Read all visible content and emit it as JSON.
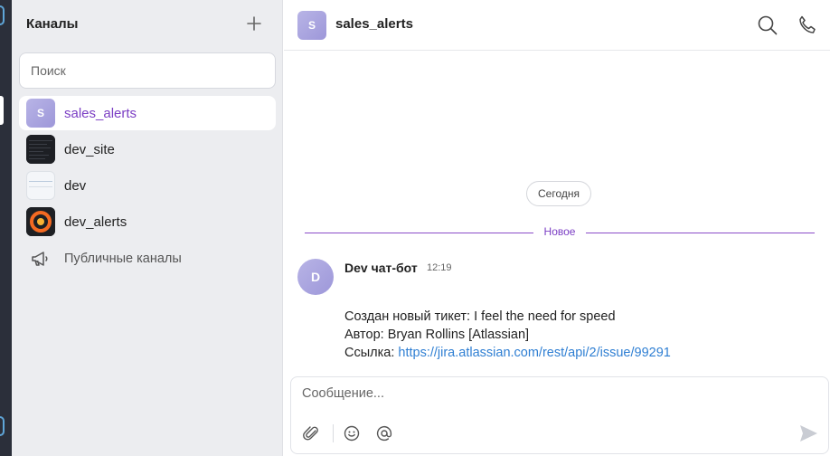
{
  "sidebar": {
    "header": "Каналы",
    "search_placeholder": "Поиск",
    "channels": [
      {
        "label": "sales_alerts",
        "avatar_letter": "S",
        "active": true
      },
      {
        "label": "dev_site",
        "active": false
      },
      {
        "label": "dev",
        "active": false
      },
      {
        "label": "dev_alerts",
        "active": false
      }
    ],
    "public_channels": "Публичные каналы"
  },
  "chat": {
    "title": "sales_alerts",
    "avatar_letter": "S",
    "date_divider": "Сегодня",
    "new_divider": "Новое",
    "message": {
      "avatar_letter": "D",
      "author": "Dev чат-бот",
      "time": "12:19",
      "line1": "Создан новый тикет: I feel the need for speed",
      "line2": "Автор: Bryan Rollins [Atlassian]",
      "line3_prefix": "Ссылка: ",
      "link": "https://jira.atlassian.com/rest/api/2/issue/99291"
    }
  },
  "composer": {
    "placeholder": "Сообщение..."
  },
  "colors": {
    "accent": "#7b3ec4",
    "sidebar_bg": "#ecedf0",
    "link": "#2f7fd3",
    "avatar": "#a8a3de"
  },
  "icons": {
    "add": "plus-icon",
    "search": "search-icon",
    "phone": "phone-icon",
    "megaphone": "megaphone-icon",
    "attach": "paperclip-icon",
    "emoji": "smiley-icon",
    "mention": "at-sign-icon",
    "send": "send-icon"
  }
}
